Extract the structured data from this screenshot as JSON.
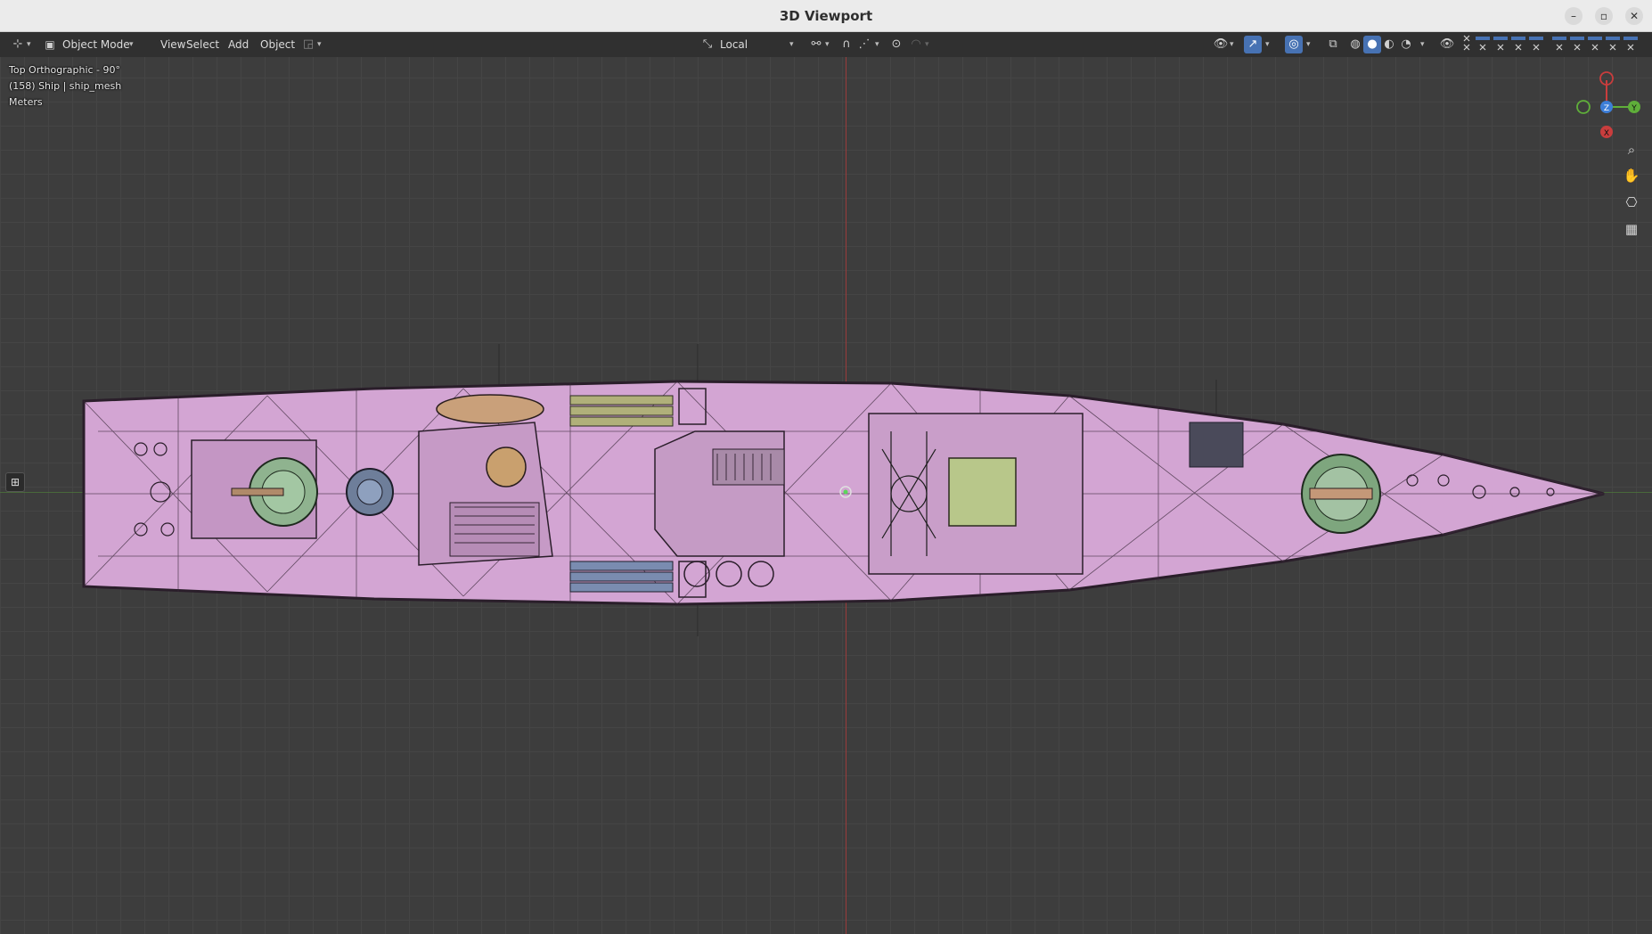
{
  "window": {
    "title": "3D Viewport",
    "minimize_glyph": "–",
    "maximize_glyph": "▫",
    "close_glyph": "✕"
  },
  "header": {
    "editor_type_icon": "axis-icon",
    "mode_label": "Object Mode",
    "menus": [
      "View",
      "Select",
      "Add",
      "Object"
    ],
    "transform_orientation": "Local",
    "accent_color": "#4772b3"
  },
  "viewport": {
    "view_name": "Top Orthographic - 90°",
    "object_info": "(158) Ship | ship_mesh",
    "units": "Meters",
    "gizmo": {
      "z_label": "Z",
      "y_label": "Y",
      "x_label": "X"
    },
    "nav_tools": [
      "zoom-icon",
      "pan-hand-icon",
      "camera-icon",
      "grid-icon"
    ],
    "mesh_color": "#d3a5d3"
  }
}
